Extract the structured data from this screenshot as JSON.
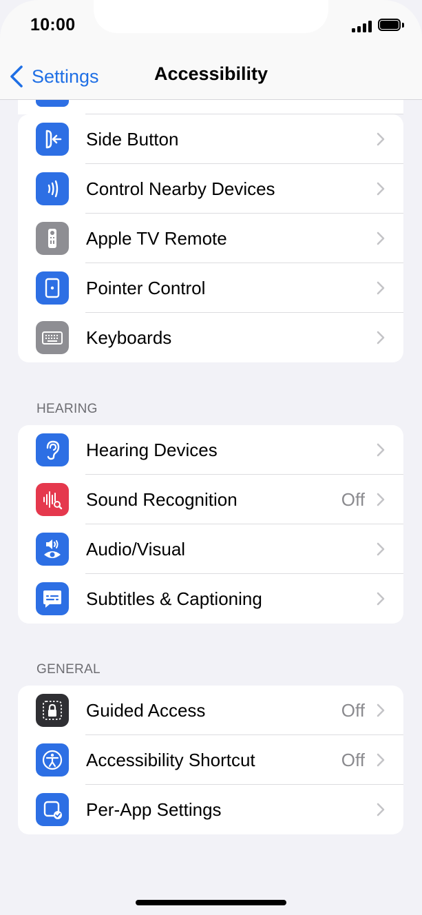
{
  "status": {
    "time": "10:00"
  },
  "nav": {
    "back_label": "Settings",
    "title": "Accessibility"
  },
  "groups": [
    {
      "header": "",
      "items": [
        {
          "label": "Side Button",
          "value": "",
          "icon": "side-button-icon",
          "color": "#2d6fe4"
        },
        {
          "label": "Control Nearby Devices",
          "value": "",
          "icon": "nearby-devices-icon",
          "color": "#2d6fe4"
        },
        {
          "label": "Apple TV Remote",
          "value": "",
          "icon": "tv-remote-icon",
          "color": "#8e8e93"
        },
        {
          "label": "Pointer Control",
          "value": "",
          "icon": "pointer-control-icon",
          "color": "#2d6fe4"
        },
        {
          "label": "Keyboards",
          "value": "",
          "icon": "keyboard-icon",
          "color": "#8e8e93"
        }
      ]
    },
    {
      "header": "HEARING",
      "items": [
        {
          "label": "Hearing Devices",
          "value": "",
          "icon": "ear-icon",
          "color": "#2d6fe4"
        },
        {
          "label": "Sound Recognition",
          "value": "Off",
          "icon": "sound-recognition-icon",
          "color": "#e5384d"
        },
        {
          "label": "Audio/Visual",
          "value": "",
          "icon": "audio-visual-icon",
          "color": "#2d6fe4"
        },
        {
          "label": "Subtitles & Captioning",
          "value": "",
          "icon": "subtitles-icon",
          "color": "#2d6fe4"
        }
      ]
    },
    {
      "header": "GENERAL",
      "items": [
        {
          "label": "Guided Access",
          "value": "Off",
          "icon": "guided-access-icon",
          "color": "#2f2f33"
        },
        {
          "label": "Accessibility Shortcut",
          "value": "Off",
          "icon": "accessibility-icon",
          "color": "#2d6fe4"
        },
        {
          "label": "Per-App Settings",
          "value": "",
          "icon": "per-app-icon",
          "color": "#2d6fe4"
        }
      ]
    }
  ]
}
